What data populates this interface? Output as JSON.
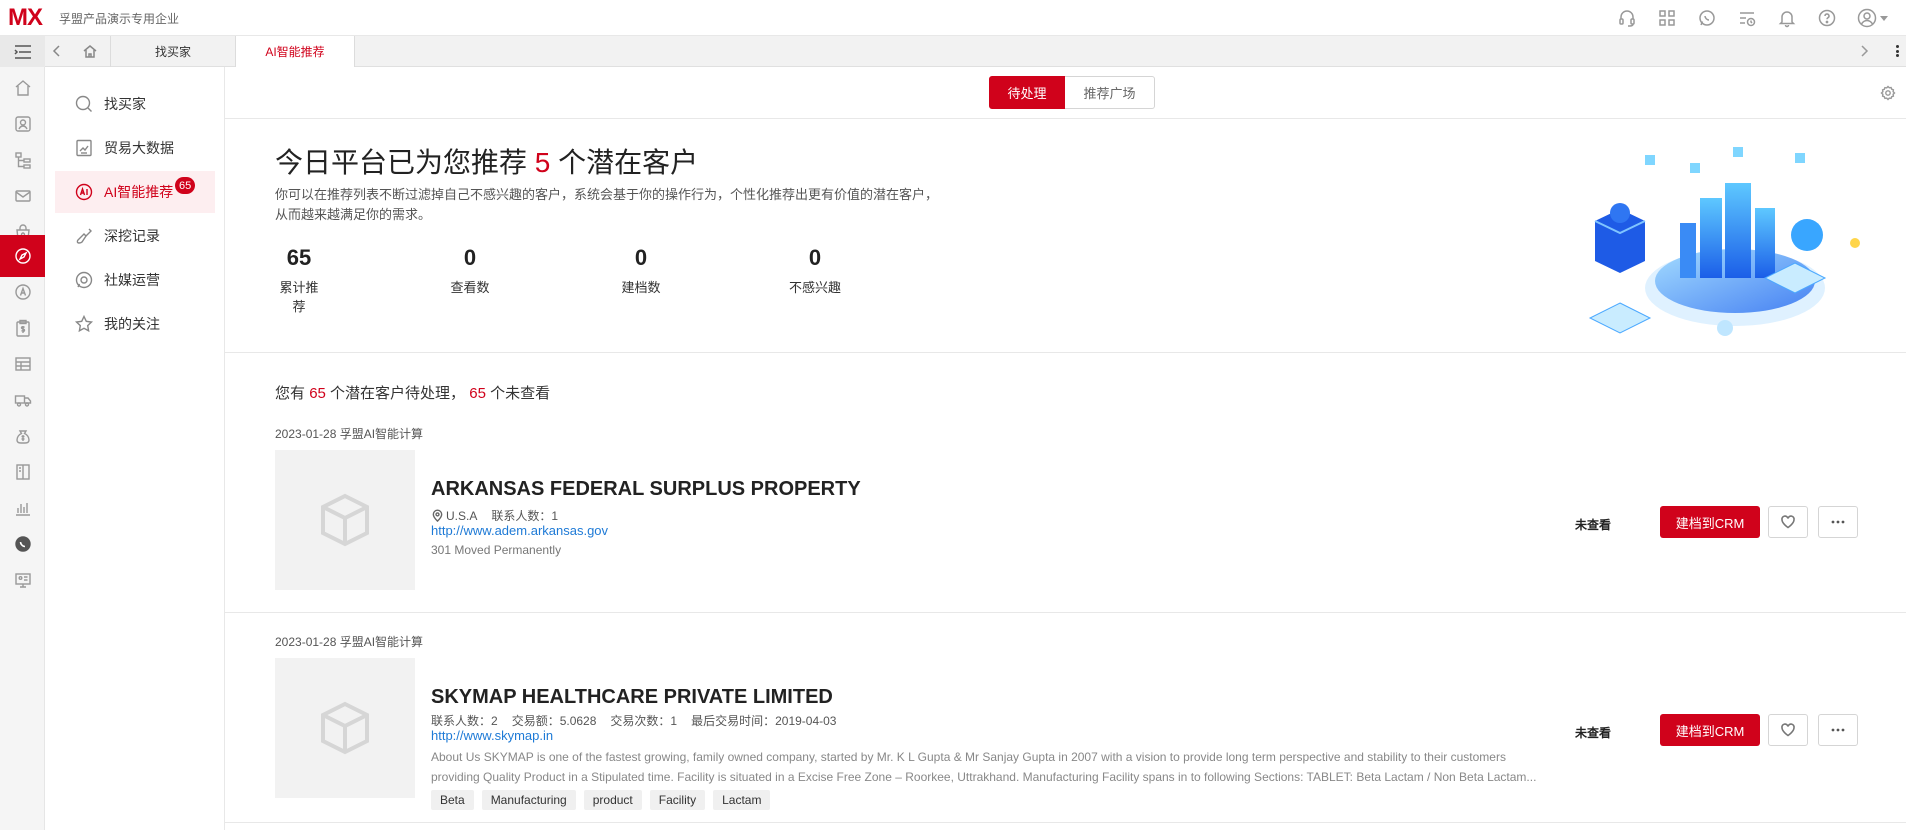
{
  "header": {
    "logo_text": "MX",
    "company": "孚盟产品演示专用企业",
    "icons": [
      "headset-icon",
      "apps-grid-icon",
      "whatsapp-icon",
      "schedule-icon",
      "bell-icon",
      "help-icon",
      "user-avatar-icon"
    ]
  },
  "tabs": [
    {
      "label": "找买家"
    },
    {
      "label": "AI智能推荐"
    }
  ],
  "rail": {
    "icons": [
      "home-icon",
      "contact-icon",
      "org-chart-icon",
      "mail-icon",
      "bag-icon",
      "compass-icon",
      "a-circle-icon",
      "clipboard-dollar-icon",
      "table-icon",
      "truck-icon",
      "money-bag-icon",
      "book-icon",
      "bar-chart-icon",
      "whatsapp-icon",
      "monitor-icon"
    ],
    "active_index": 5
  },
  "subnav": {
    "items": [
      {
        "label": "找买家",
        "icon": "search-icon"
      },
      {
        "label": "贸易大数据",
        "icon": "data-icon"
      },
      {
        "label": "AI智能推荐",
        "icon": "ai-icon",
        "badge": "65",
        "active": true
      },
      {
        "label": "深挖记录",
        "icon": "shovel-icon"
      },
      {
        "label": "社媒运营",
        "icon": "chat-icon"
      },
      {
        "label": "我的关注",
        "icon": "star-icon"
      }
    ]
  },
  "segment": {
    "active": "待处理",
    "inactive": "推荐广场"
  },
  "hero": {
    "headline_prefix": "今日平台已为您推荐",
    "headline_count": "5",
    "headline_suffix": "个潜在客户",
    "desc_line1": "你可以在推荐列表不断过滤掉自己不感兴趣的客户，系统会基于你的操作行为，个性化推荐出更有价值的潜在客户，",
    "desc_line2": "从而越来越满足你的需求。",
    "stats": [
      {
        "value": "65",
        "label": "累计推荐"
      },
      {
        "value": "0",
        "label": "查看数"
      },
      {
        "value": "0",
        "label": "建档数"
      },
      {
        "value": "0",
        "label": "不感兴趣"
      }
    ]
  },
  "summary": {
    "prefix": "您有",
    "pending": "65",
    "middle": "个潜在客户待处理，",
    "unviewed": "65",
    "suffix": "个未查看"
  },
  "cards": [
    {
      "date": "2023-01-28 孚盟AI智能计算",
      "title": "ARKANSAS FEDERAL SURPLUS PROPERTY",
      "country": "U.S.A",
      "contacts": "联系人数：1",
      "url": "http://www.adem.arkansas.gov",
      "sub": "301 Moved Permanently",
      "status": "未查看",
      "crm_button": "建档到CRM"
    },
    {
      "date": "2023-01-28 孚盟AI智能计算",
      "title": "SKYMAP HEALTHCARE PRIVATE LIMITED",
      "meta": [
        "联系人数：2",
        "交易额：5.0628",
        "交易次数：1",
        "最后交易时间：2019-04-03"
      ],
      "url": "http://www.skymap.in",
      "desc_line1": "About Us SKYMAP is one of the fastest growing, family owned company, started by Mr. K L Gupta & Mr Sanjay Gupta in 2007 with a vision to provide long term perspective and stability to their customers",
      "desc_line2": "providing Quality Product in a Stipulated time. Facility is situated in a Excise Free Zone – Roorkee, Uttrakhand. Manufacturing Facility spans in to following Sections: TABLET: Beta Lactam / Non Beta Lactam...",
      "tags": [
        "Beta",
        "Manufacturing",
        "product",
        "Facility",
        "Lactam"
      ],
      "status": "未查看",
      "crm_button": "建档到CRM"
    }
  ],
  "colors": {
    "accent": "#d0021b",
    "link": "#1e7ad6"
  }
}
